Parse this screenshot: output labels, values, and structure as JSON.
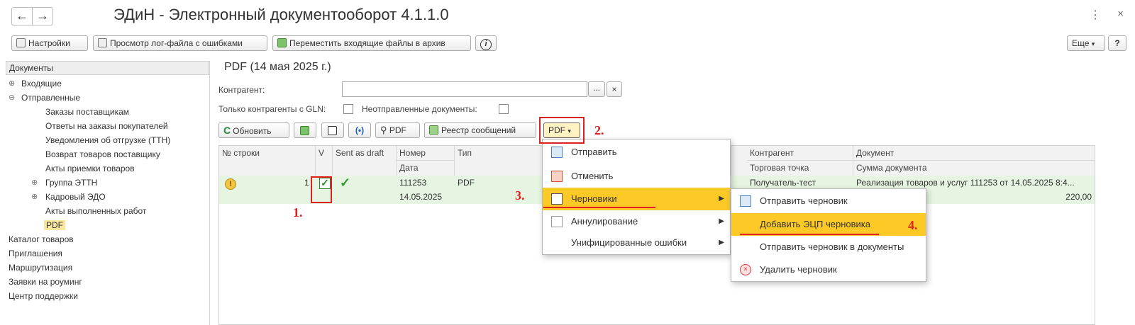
{
  "window": {
    "title": "ЭДиН - Электронный документооборот 4.1.1.0",
    "back_glyph": "←",
    "forward_glyph": "→",
    "more_glyph": "⋮",
    "close_glyph": "×"
  },
  "toolbar": {
    "settings_label": "Настройки",
    "log_label": "Просмотр лог-файла с ошибками",
    "move_label": "Переместить входящие файлы в архив",
    "info_glyph": "i",
    "more_label": "Еще",
    "help_label": "?"
  },
  "sidebar": {
    "header": "Документы",
    "items": [
      {
        "label": "Входящие",
        "toggle": "⊕"
      },
      {
        "label": "Отправленные",
        "toggle": "⊖"
      },
      {
        "label": "Заказы поставщикам"
      },
      {
        "label": "Ответы на заказы покупателей"
      },
      {
        "label": "Уведомления об отгрузке (ТТН)"
      },
      {
        "label": "Возврат товаров поставщику"
      },
      {
        "label": "Акты приемки товаров"
      },
      {
        "label": "Группа ЭТТН",
        "toggle": "⊕"
      },
      {
        "label": "Кадровый ЭДО",
        "toggle": "⊕"
      },
      {
        "label": "Акты выполненных работ"
      },
      {
        "label": "PDF"
      },
      {
        "label": "Каталог товаров"
      },
      {
        "label": "Приглашения"
      },
      {
        "label": "Маршрутизация"
      },
      {
        "label": "Заявки на роуминг"
      },
      {
        "label": "Центр поддержки"
      }
    ]
  },
  "main": {
    "title": "PDF (14 мая 2025 г.)",
    "counterparty_label": "Контрагент:",
    "counterparty_value": "",
    "select_glyph": "...",
    "clear_glyph": "×",
    "gln_label": "Только контрагенты с GLN:",
    "unsent_label": "Неотправленные документы:",
    "refresh_label": "Обновить",
    "pdf_btn_label": "PDF",
    "registry_label": "Реестр сообщений",
    "pdf_menu_label": "PDF"
  },
  "table": {
    "headers_top": [
      "№ строки",
      "V",
      "Sent as draft",
      "Номер",
      "Тип",
      "Контрагент",
      "Документ"
    ],
    "headers_bottom": [
      "Дата",
      "Торговая точка",
      "Сумма документа"
    ],
    "row": {
      "line_no": "1",
      "number": "111253",
      "date": "14.05.2025",
      "type": "PDF",
      "counterparty": "Получатель-тест",
      "document": "Реализация товаров и услуг 111253 от 14.05.2025 8:4...",
      "amount": "220,00"
    }
  },
  "menu_main": {
    "items": [
      {
        "label": "Отправить"
      },
      {
        "label": "Отменить"
      },
      {
        "label": "Черновики"
      },
      {
        "label": "Аннулирование"
      },
      {
        "label": "Унифицированные ошибки"
      }
    ]
  },
  "menu_drafts": {
    "items": [
      {
        "label": "Отправить черновик"
      },
      {
        "label": "Добавить ЭЦП черновика"
      },
      {
        "label": "Отправить черновик в документы"
      },
      {
        "label": "Удалить черновик"
      }
    ]
  },
  "steps": [
    "1.",
    "2.",
    "3.",
    "4."
  ],
  "colors": {
    "accent": "#fcc927",
    "annotation": "#e02020",
    "row_highlight": "#e6f5e1",
    "selected_item": "#f9e79f"
  }
}
